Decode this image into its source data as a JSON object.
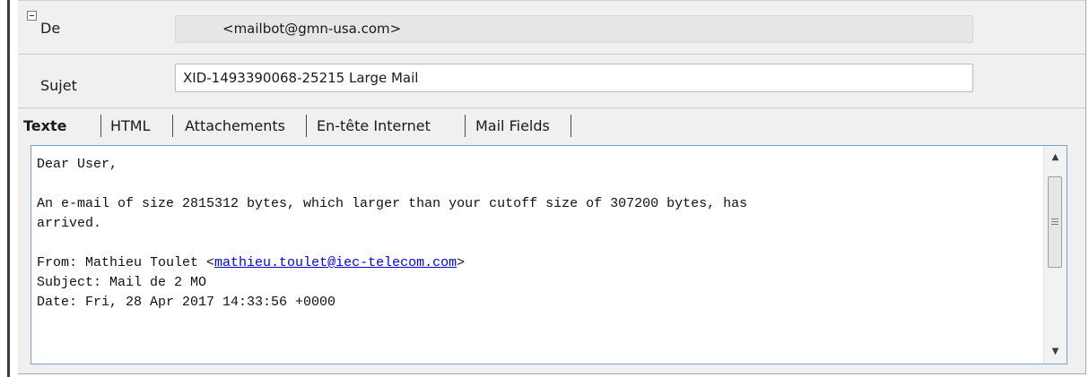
{
  "header": {
    "from_label": "De",
    "from_value": "<mailbot@gmn-usa.com>",
    "subject_label": "Sujet",
    "subject_value": "XID-1493390068-25215 Large Mail"
  },
  "tabs": [
    {
      "label": "Texte",
      "active": true
    },
    {
      "label": "HTML",
      "active": false
    },
    {
      "label": "Attachements",
      "active": false
    },
    {
      "label": "En-tête Internet",
      "active": false
    },
    {
      "label": "Mail Fields",
      "active": false
    }
  ],
  "message": {
    "line1": "Dear User,",
    "line2": "An e-mail of size 2815312 bytes, which larger than your cutoff size of 307200 bytes, has",
    "line3": "arrived.",
    "from_prefix": "From: Mathieu Toulet <",
    "from_email": "mathieu.toulet@iec-telecom.com",
    "from_suffix": ">",
    "subject_line": "Subject: Mail de 2 MO",
    "date_line": "Date: Fri, 28 Apr 2017 14:33:56 +0000"
  },
  "icons": {
    "collapse": "collapse-minus-icon",
    "scroll_up": "scroll-up-arrow-icon",
    "scroll_down": "scroll-down-arrow-icon"
  }
}
